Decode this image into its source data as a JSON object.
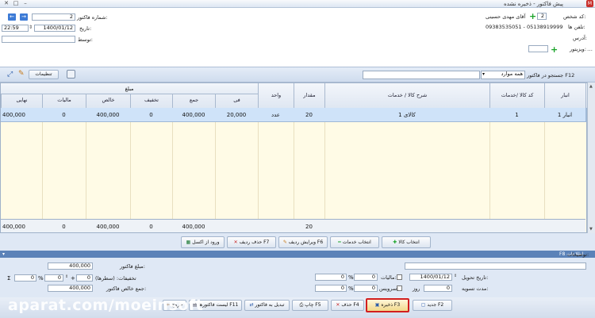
{
  "window": {
    "title": "پیش فاکتور - ذخیره نشده",
    "min": "–",
    "max": "□",
    "close": "✕"
  },
  "header": {
    "person_code_label": "کد شخص:",
    "person_code": "2",
    "person_name": "آقای مهدی حسینی",
    "phone_label": "تلفن ها:",
    "phone_value": "09383535051 - 05138919999",
    "address_label": "آدرس:",
    "visitor_label": "ویزیتور:",
    "invoice_no_label": "شماره فاکتور:",
    "invoice_no": "2",
    "date_label": "تاریخ:",
    "date": "1400/01/12",
    "time": "22:59",
    "mediator_label": "توسط:"
  },
  "toolbar": {
    "settings_label": "تنظیمات",
    "search_label": "جستجو در فاکتور F12",
    "search_scope": "همه موارد"
  },
  "grid": {
    "headers": {
      "store": "انبار",
      "code": "کد کالا /خدمات",
      "desc": "شرح کالا / خدمات",
      "qty": "مقدار",
      "unit": "واحد",
      "amount_group": "مبلغ",
      "unit_price": "فی",
      "total": "جمع",
      "discount": "تخفیف",
      "net": "خالص",
      "tax": "مالیات",
      "final": "نهایی"
    },
    "rows": [
      {
        "row": "1",
        "store": "انبار 1",
        "code": "1",
        "desc": "کالای 1",
        "qty": "20",
        "unit": "عدد",
        "unit_price": "20,000",
        "total": "400,000",
        "discount": "0",
        "net": "400,000",
        "tax": "0",
        "final": "400,000"
      }
    ],
    "totals": {
      "qty": "20",
      "total": "400,000",
      "discount": "0",
      "net": "400,000",
      "tax": "0",
      "final": "400,000"
    }
  },
  "actions": {
    "select_goods": "انتخاب کالا",
    "select_services": "انتخاب خدمات",
    "edit_row": "ویرایش ردیف F6",
    "delete_row": "حذف ردیف F7",
    "excel": "ورود از اکسل"
  },
  "more_info": "F8 اطلاعات بیشتر",
  "summary": {
    "invoice_amount_label": "مبلغ فاکتور:",
    "invoice_amount": "400,000",
    "discounts_label": "تخفیفات: (سطرها)",
    "discount_rows": "0",
    "discount_pct": "0",
    "percent": "%",
    "plus": "+",
    "sigma": "Σ",
    "net_label": "جمع خالص فاکتور:",
    "net_amount": "400,000",
    "notes_label": "توضیحات:",
    "delivery_label": "تاریخ تحویل:",
    "delivery_date": "1400/01/12",
    "settle_label": "مدت تسویه:",
    "settle_days": "0",
    "days_unit": "روز",
    "tax_label": "مالیات:",
    "tax_value": "0",
    "services_label": "سرویس:",
    "services_value": "0"
  },
  "footer": {
    "new": "جدید F2",
    "save": "ذخیره F3",
    "delete": "حذف F4",
    "print": "چاپ F5",
    "convert": "تبدیل به فاکتور",
    "list": "لیست فاکتورها F11",
    "exit": "خروج"
  },
  "watermark": "aparat.com/moeinsoft"
}
